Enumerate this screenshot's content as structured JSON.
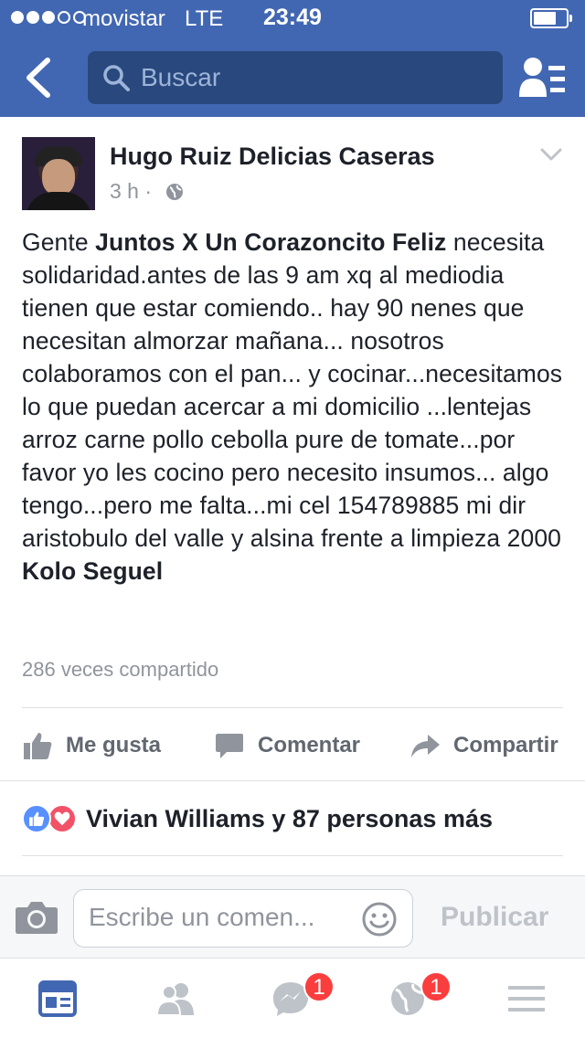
{
  "status_bar": {
    "carrier": "movistar",
    "network": "LTE",
    "time": "23:49"
  },
  "nav": {
    "search_placeholder": "Buscar"
  },
  "post": {
    "author": "Hugo Ruiz Delicias Caseras",
    "time": "3 h ·",
    "text_intro": "Gente ",
    "text_page_mention": "Juntos X Un Corazoncito Feliz",
    "text_body": " necesita solidaridad.antes de las 9 am xq al mediodia tienen que estar comiendo.. hay 90 nenes que necesitan almorzar mañana... nosotros colaboramos con el pan... y cocinar...necesitamos lo que puedan acercar a mi domicilio ...lentejas arroz carne pollo cebolla pure de tomate...por favor yo les cocino pero necesito insumos... algo tengo...pero me falta...mi cel 154789885 mi dir aristobulo del valle y alsina frente a limpieza 2000 ",
    "text_user_mention": "Kolo Seguel",
    "shares": "286 veces compartido"
  },
  "actions": {
    "like": "Me gusta",
    "comment": "Comentar",
    "share": "Compartir"
  },
  "reactions": {
    "summary": "Vivian Williams y 87 personas más"
  },
  "composer": {
    "placeholder": "Escribe un comen...",
    "publish": "Publicar"
  },
  "tabbar": {
    "messenger_badge": "1",
    "notifications_badge": "1"
  },
  "colors": {
    "brand": "#4267b2",
    "badge": "#fa3e3e",
    "like": "#5890ff",
    "love": "#f25268"
  }
}
